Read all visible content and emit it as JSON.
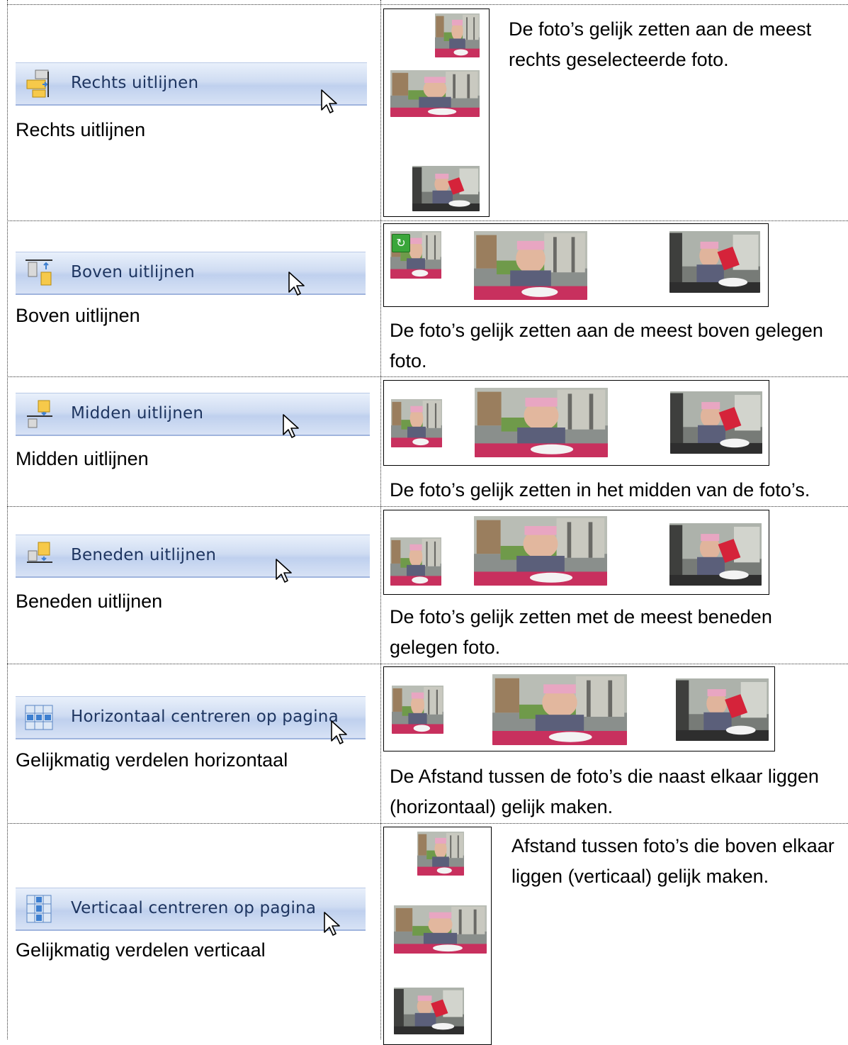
{
  "rows": [
    {
      "menu_label": "Rechts uitlijnen",
      "label": "Rechts uitlijnen",
      "description": "De foto’s gelijk zetten aan de meest rechts geselecteerde foto."
    },
    {
      "menu_label": "Boven uitlijnen",
      "label": "Boven uitlijnen",
      "description": "De foto’s gelijk zetten aan de meest boven gelegen foto."
    },
    {
      "menu_label": "Midden uitlijnen",
      "label": "Midden uitlijnen",
      "description": "De foto’s gelijk zetten in het midden van de foto’s."
    },
    {
      "menu_label": "Beneden uitlijnen",
      "label": "Beneden uitlijnen",
      "description": "De foto’s gelijk zetten met de meest beneden gelegen foto."
    },
    {
      "menu_label": "Horizontaal centreren op pagina",
      "label": "Gelijkmatig verdelen horizontaal",
      "description": "De Afstand tussen de foto’s die naast elkaar liggen (horizontaal) gelijk maken."
    },
    {
      "menu_label": "Verticaal centreren op pagina",
      "label": "Gelijkmatig verdelen verticaal",
      "description": "Afstand tussen foto’s die boven elkaar liggen (verticaal) gelijk maken."
    }
  ],
  "icons": {
    "row1": "align-right-icon",
    "row2": "align-top-icon",
    "row3": "align-middle-icon",
    "row4": "align-bottom-icon",
    "row5": "distribute-horizontal-icon",
    "row6": "distribute-vertical-icon",
    "cursor": "mouse-pointer-icon",
    "photo": "photo-thumbnail-icon",
    "badge": "refresh-badge-icon"
  },
  "colors": {
    "menu_text": "#1e3560",
    "menu_border": "#9fb4dd",
    "icon_yellow": "#f6c94a",
    "icon_blue": "#3d7fd0",
    "badge_green": "#3aa63a"
  }
}
